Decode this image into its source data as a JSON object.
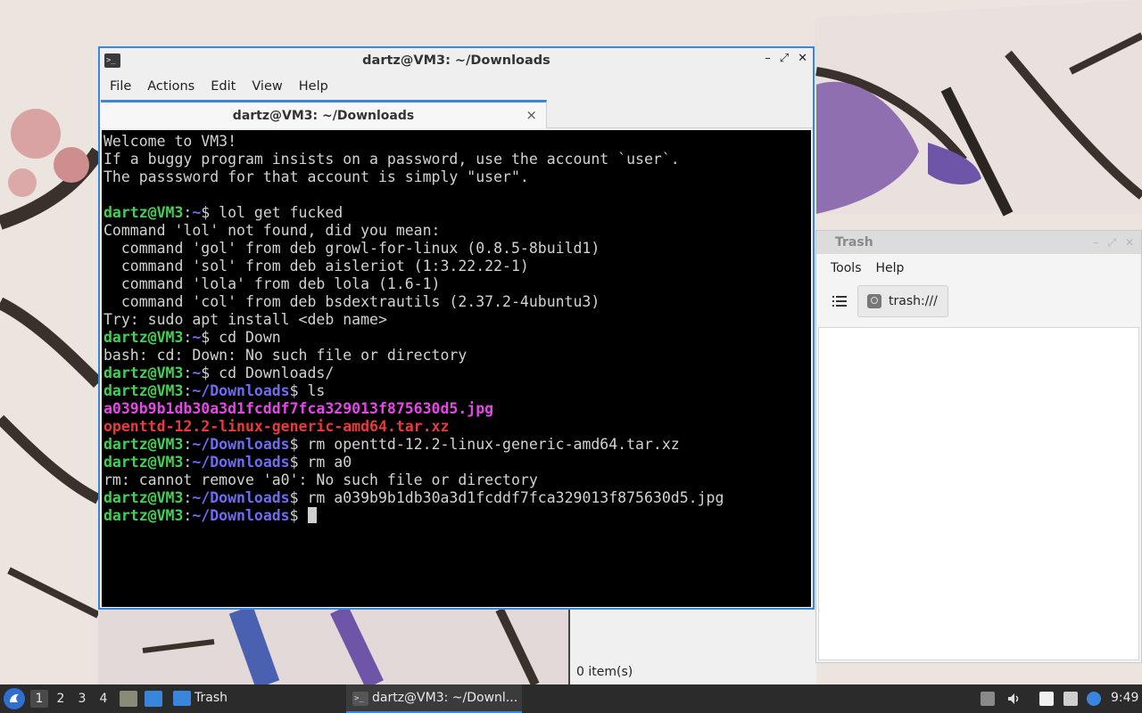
{
  "terminal": {
    "title": "dartz@VM3: ~/Downloads",
    "menu": [
      "File",
      "Actions",
      "Edit",
      "View",
      "Help"
    ],
    "tab_label": "dartz@VM3: ~/Downloads",
    "tab_close": "×",
    "window_buttons": [
      "–",
      "⤢",
      "✕"
    ],
    "lines": [
      [
        {
          "t": "Welcome to VM3!",
          "c": ""
        }
      ],
      [
        {
          "t": "If a buggy program insists on a password, use the account `user`.",
          "c": ""
        }
      ],
      [
        {
          "t": "The passsword for that account is simply \"user\".",
          "c": ""
        }
      ],
      [
        {
          "t": "",
          "c": ""
        }
      ],
      [
        {
          "t": "dartz@VM3",
          "c": "u"
        },
        {
          "t": ":",
          "c": ""
        },
        {
          "t": "~",
          "c": "p"
        },
        {
          "t": "$ lol get fucked",
          "c": ""
        }
      ],
      [
        {
          "t": "Command 'lol' not found, did you mean:",
          "c": ""
        }
      ],
      [
        {
          "t": "  command 'gol' from deb growl-for-linux (0.8.5-8build1)",
          "c": ""
        }
      ],
      [
        {
          "t": "  command 'sol' from deb aisleriot (1:3.22.22-1)",
          "c": ""
        }
      ],
      [
        {
          "t": "  command 'lola' from deb lola (1.6-1)",
          "c": ""
        }
      ],
      [
        {
          "t": "  command 'col' from deb bsdextrautils (2.37.2-4ubuntu3)",
          "c": ""
        }
      ],
      [
        {
          "t": "Try: sudo apt install <deb name>",
          "c": ""
        }
      ],
      [
        {
          "t": "dartz@VM3",
          "c": "u"
        },
        {
          "t": ":",
          "c": ""
        },
        {
          "t": "~",
          "c": "p"
        },
        {
          "t": "$ cd Down",
          "c": ""
        }
      ],
      [
        {
          "t": "bash: cd: Down: No such file or directory",
          "c": ""
        }
      ],
      [
        {
          "t": "dartz@VM3",
          "c": "u"
        },
        {
          "t": ":",
          "c": ""
        },
        {
          "t": "~",
          "c": "p"
        },
        {
          "t": "$ cd Downloads/",
          "c": ""
        }
      ],
      [
        {
          "t": "dartz@VM3",
          "c": "u"
        },
        {
          "t": ":",
          "c": ""
        },
        {
          "t": "~/Downloads",
          "c": "p"
        },
        {
          "t": "$ ls",
          "c": ""
        }
      ],
      [
        {
          "t": "a039b9b1db30a3d1fcddf7fca329013f875630d5.jpg",
          "c": "f1"
        }
      ],
      [
        {
          "t": "openttd-12.2-linux-generic-amd64.tar.xz",
          "c": "f2"
        }
      ],
      [
        {
          "t": "dartz@VM3",
          "c": "u"
        },
        {
          "t": ":",
          "c": ""
        },
        {
          "t": "~/Downloads",
          "c": "p"
        },
        {
          "t": "$ rm openttd-12.2-linux-generic-amd64.tar.xz",
          "c": ""
        }
      ],
      [
        {
          "t": "dartz@VM3",
          "c": "u"
        },
        {
          "t": ":",
          "c": ""
        },
        {
          "t": "~/Downloads",
          "c": "p"
        },
        {
          "t": "$ rm a0",
          "c": ""
        }
      ],
      [
        {
          "t": "rm: cannot remove 'a0': No such file or directory",
          "c": ""
        }
      ],
      [
        {
          "t": "dartz@VM3",
          "c": "u"
        },
        {
          "t": ":",
          "c": ""
        },
        {
          "t": "~/Downloads",
          "c": "p"
        },
        {
          "t": "$ rm a039b9b1db30a3d1fcddf7fca329013f875630d5.jpg",
          "c": ""
        }
      ],
      [
        {
          "t": "dartz@VM3",
          "c": "u"
        },
        {
          "t": ":",
          "c": ""
        },
        {
          "t": "~/Downloads",
          "c": "p"
        },
        {
          "t": "$ ",
          "c": ""
        }
      ]
    ]
  },
  "filemanager": {
    "title": "Trash",
    "menu": [
      "Tools",
      "Help"
    ],
    "path": "trash:///",
    "status": "0 item(s)",
    "icons": {
      "view": "list-view-icon",
      "path": "drive-icon"
    }
  },
  "taskbar": {
    "start_icon": "lubuntu-logo-icon",
    "workspaces": [
      "1",
      "2",
      "3",
      "4"
    ],
    "active_workspace": "1",
    "trash_label": "Trash",
    "terminal_label": "dartz@VM3: ~/Downl...",
    "clock": "9:49"
  },
  "colors": {
    "accent": "#3b86d8",
    "prompt_user": "#43d153",
    "prompt_path": "#6e6cf3",
    "file_image": "#e548e6",
    "file_archive": "#ea3a3a"
  }
}
